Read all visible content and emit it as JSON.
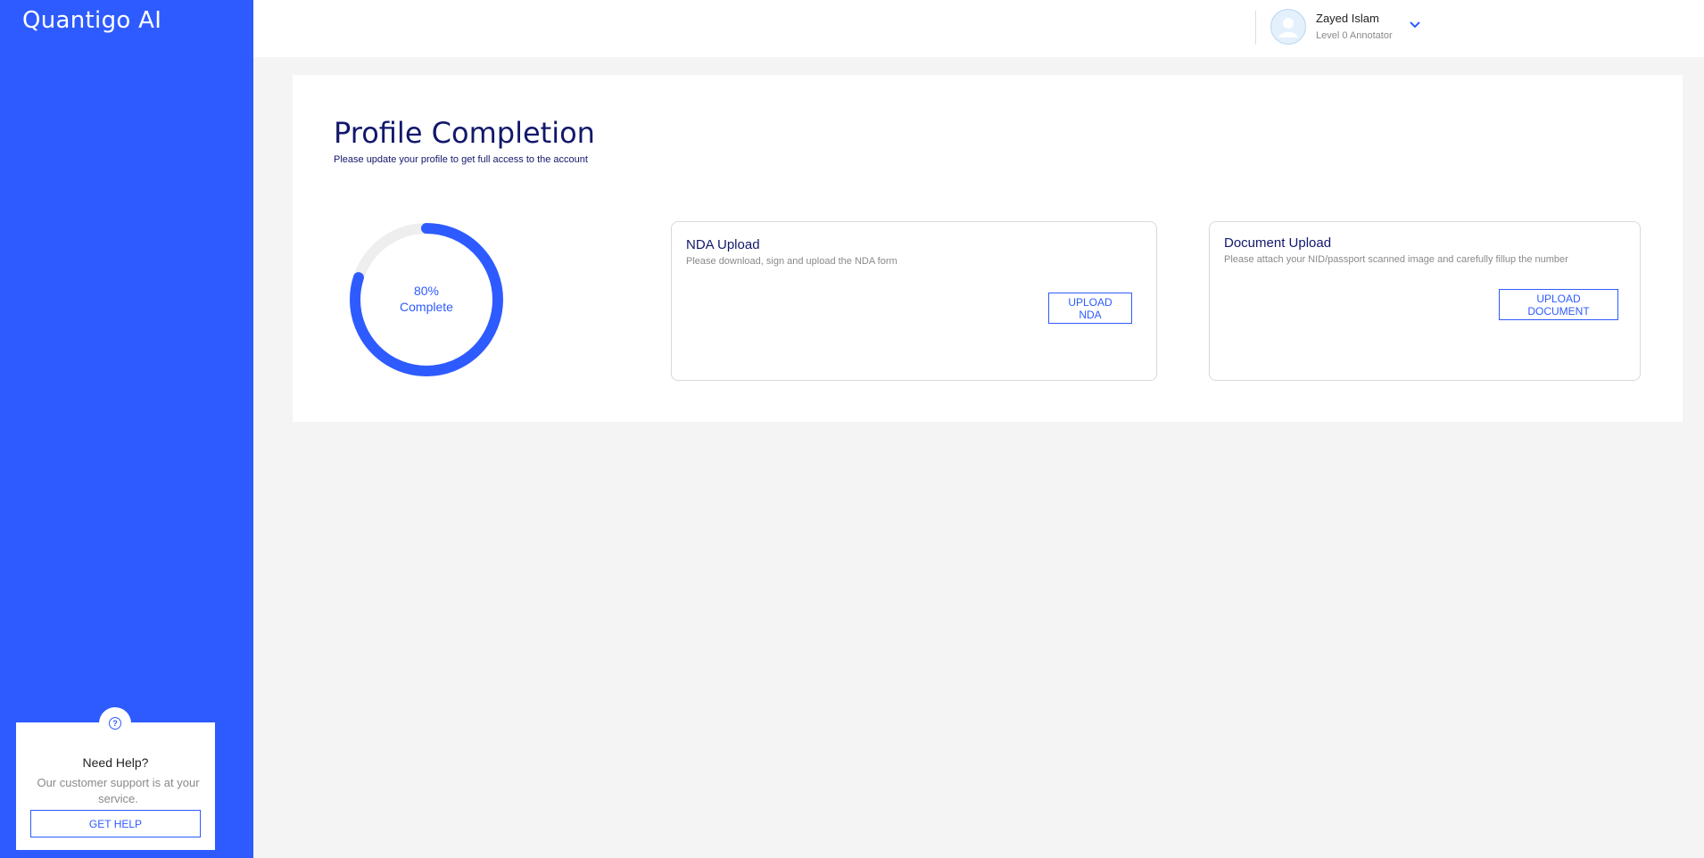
{
  "brand": {
    "name": "Quantigo AI"
  },
  "help": {
    "title": "Need Help?",
    "text": "Our customer support is at your service.",
    "button_label": "GET HELP"
  },
  "user": {
    "name": "Zayed Islam",
    "role": "Level 0 Annotator"
  },
  "page": {
    "title": "Profile Completion",
    "subtitle": "Please update your profile to get full access to the account"
  },
  "progress": {
    "value": 0.8,
    "percent_label": "80%",
    "complete_label": "Complete",
    "color": "#2e5bff"
  },
  "nda_card": {
    "title": "NDA Upload",
    "description": "Please download, sign and upload the NDA form",
    "button_label": "UPLOAD NDA"
  },
  "document_card": {
    "title": "Document Upload",
    "description": "Please attach your NID/passport scanned image and carefully fillup the number",
    "button_label": "UPLOAD DOCUMENT"
  },
  "colors": {
    "sidebar": "#2e5bff",
    "title": "#12186b",
    "background": "#f4f4f4"
  },
  "icons": {
    "help": "question-circle-icon",
    "avatar": "user-avatar-icon",
    "menu": "chevron-down-icon"
  }
}
